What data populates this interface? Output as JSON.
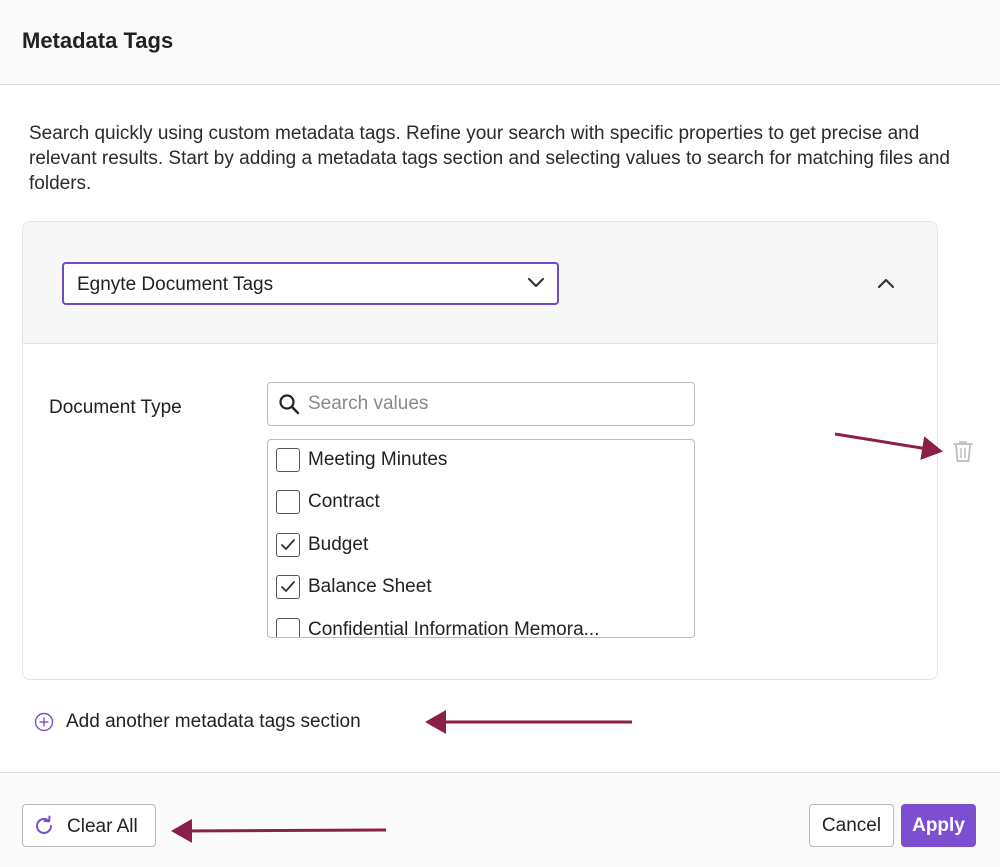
{
  "dialog": {
    "title": "Metadata Tags"
  },
  "description": "Search quickly using custom metadata tags. Refine your search with specific properties to get precise and relevant results. Start by adding a metadata tags section and selecting values to search for matching files and folders.",
  "section": {
    "selected_tag": "Egnyte Document Tags",
    "field_label": "Document Type",
    "search_placeholder": "Search values",
    "search_value": "",
    "values": [
      {
        "label": "Meeting Minutes",
        "checked": false
      },
      {
        "label": "Contract",
        "checked": false
      },
      {
        "label": "Budget",
        "checked": true
      },
      {
        "label": "Balance Sheet",
        "checked": true
      },
      {
        "label": "Confidential Information Memora...",
        "checked": false
      }
    ]
  },
  "add_section_label": "Add another metadata tags section",
  "footer": {
    "clear_label": "Clear All",
    "cancel_label": "Cancel",
    "apply_label": "Apply"
  },
  "colors": {
    "accent": "#7b4fd0",
    "select_border": "#6f4cc6",
    "annotation_arrow": "#8b1f4a"
  },
  "icons": [
    "chevron-down-icon",
    "chevron-up-icon",
    "search-icon",
    "check-icon",
    "trash-icon",
    "plus-circle-icon",
    "refresh-icon"
  ]
}
